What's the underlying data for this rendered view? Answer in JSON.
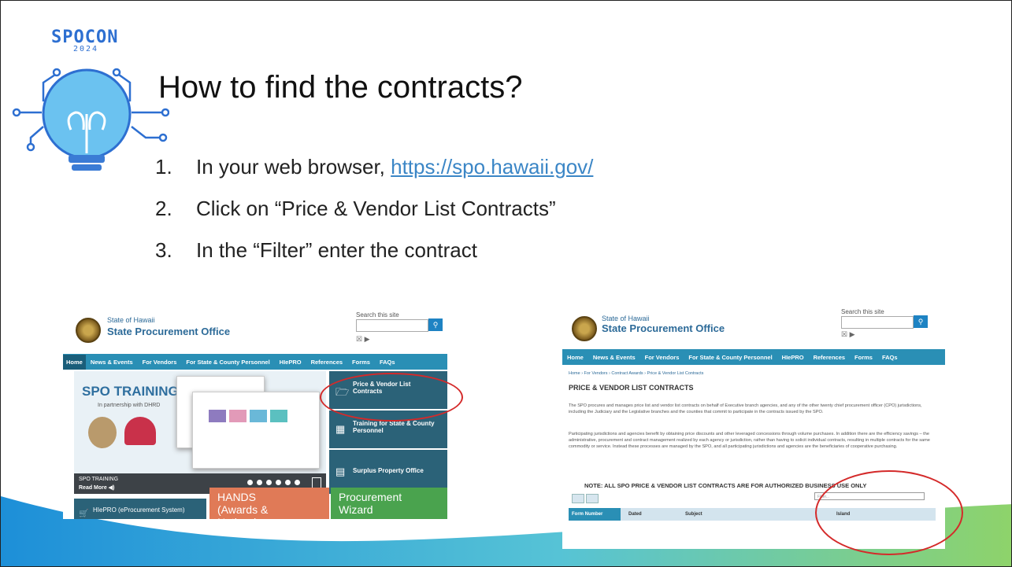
{
  "logo": {
    "name": "SPOCON",
    "year": "2024"
  },
  "title": "How to find the contracts?",
  "steps": [
    {
      "num": "1.",
      "text": "In your web browser, ",
      "link": "https://spo.hawaii.gov/"
    },
    {
      "num": "2.",
      "text": "Click on “Price & Vendor List Contracts”"
    },
    {
      "num": "3.",
      "text": "In the “Filter” enter the contract"
    }
  ],
  "site": {
    "state": "State of Hawaii",
    "office": "State Procurement Office",
    "search_label": "Search this site",
    "search_icon": "search-icon",
    "nav": [
      "Home",
      "News & Events",
      "For Vendors",
      "For State & County Personnel",
      "HIePRO",
      "References",
      "Forms",
      "FAQs"
    ]
  },
  "shot1": {
    "training_title": "SPO TRAINING",
    "training_sub": "In partnership with DHRD",
    "carousel_caption": "SPO TRAINING",
    "read_more": "Read More ◀)",
    "tiles": [
      {
        "label": "Price & Vendor List Contracts",
        "icon": "folder-open-icon"
      },
      {
        "label": "Training for State & County Personnel",
        "icon": "calendar-icon"
      },
      {
        "label": "Surplus Property Office",
        "icon": "car-icon"
      }
    ],
    "bottom_tiles": [
      {
        "label": "HIePRO (eProcurement System)",
        "icon": "cart-icon"
      },
      {
        "label": "HANDS (Awards & Notices)"
      },
      {
        "label": "Procurement Wizard"
      }
    ]
  },
  "shot2": {
    "breadcrumb": "Home › For Vendors › Contract Awards › Price & Vendor List Contracts",
    "heading": "PRICE & VENDOR LIST CONTRACTS",
    "para1": "The SPO procures and manages price list and vendor list contracts on behalf of Executive branch agencies, and any of the other twenty chief procurement officer (CPO) jurisdictions, including the Judiciary and the Legislative branches and the counties that commit to participate in the contracts issued by the SPO.",
    "para2": "Participating jurisdictions and agencies benefit by obtaining price discounts and other leveraged concessions through volume purchases. In addition there are the efficiency savings – the administrative, procurement and contract management realized by each agency or jurisdiction, rather than having to solicit individual contracts, resulting in multiple contracts for the same commodity or service. Instead these processes are managed by the SPO, and all participating jurisdictions and agencies are the beneficiaries of cooperative purchasing.",
    "note": "NOTE: ALL SPO PRICE & VENDOR LIST CONTRACTS ARE FOR AUTHORIZED BUSINESS USE ONLY",
    "filter_placeholder": "Filter...",
    "columns": [
      "Form Number",
      "Dated",
      "Subject",
      "Island"
    ]
  },
  "colors": {
    "accent": "#2a8fb5",
    "highlight": "#d42a2a",
    "link": "#3b86c6"
  }
}
